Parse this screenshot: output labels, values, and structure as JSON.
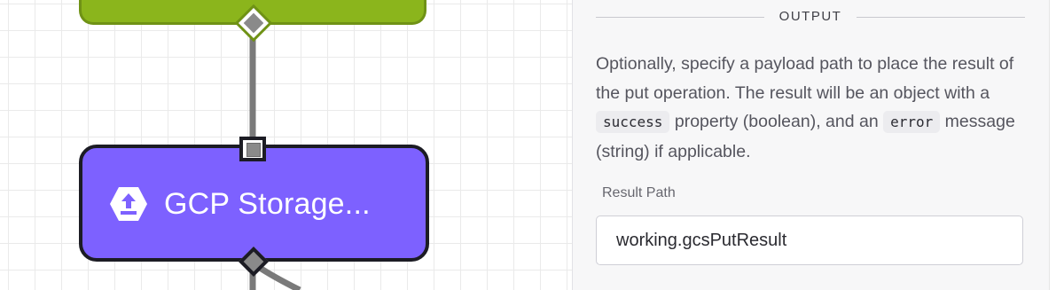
{
  "canvas": {
    "node": {
      "title": "GCP Storage...",
      "icon": "upload-icon",
      "color": "#7d61ff"
    },
    "previous_node_color": "#8bb51c"
  },
  "panel": {
    "section_title": "OUTPUT",
    "help": {
      "part1": "Optionally, specify a payload path to place the result of the put operation. The result will be an object with a ",
      "code1": "success",
      "part2": " property (boolean), and an ",
      "code2": "error",
      "part3": " message (string) if applicable."
    },
    "result_path": {
      "label": "Result Path",
      "value": "working.gcsPutResult"
    }
  }
}
